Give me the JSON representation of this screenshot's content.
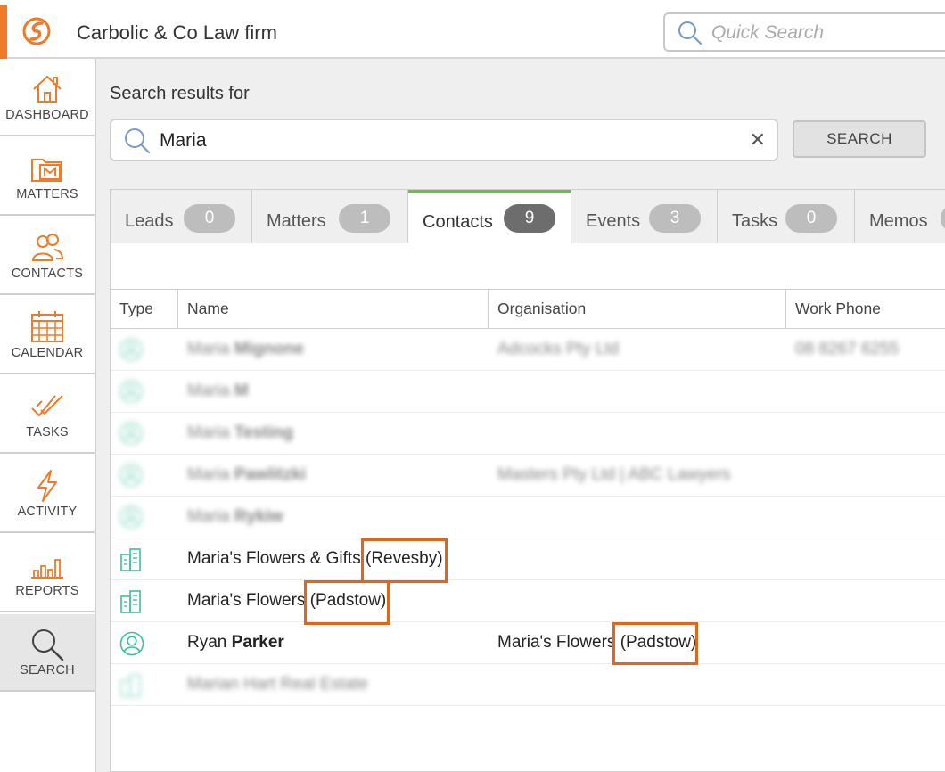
{
  "header": {
    "firm_name": "Carbolic & Co Law firm",
    "quick_search_placeholder": "Quick Search",
    "accent_color": "#ef7a2a"
  },
  "sidebar": {
    "items": [
      {
        "label": "DASHBOARD",
        "icon": "home-icon"
      },
      {
        "label": "MATTERS",
        "icon": "matters-folder-icon"
      },
      {
        "label": "CONTACTS",
        "icon": "contacts-icon"
      },
      {
        "label": "CALENDAR",
        "icon": "calendar-icon"
      },
      {
        "label": "TASKS",
        "icon": "tasks-check-icon"
      },
      {
        "label": "ACTIVITY",
        "icon": "lightning-icon"
      },
      {
        "label": "REPORTS",
        "icon": "bar-chart-icon"
      },
      {
        "label": "SEARCH",
        "icon": "search-icon",
        "active": true
      }
    ]
  },
  "search": {
    "results_for_label": "Search results for",
    "query": "Maria",
    "clear_symbol": "✕",
    "button_label": "SEARCH"
  },
  "tabs": [
    {
      "label": "Leads",
      "count": "0"
    },
    {
      "label": "Matters",
      "count": "1"
    },
    {
      "label": "Contacts",
      "count": "9",
      "active": true
    },
    {
      "label": "Events",
      "count": "3"
    },
    {
      "label": "Tasks",
      "count": "0"
    },
    {
      "label": "Memos",
      "count": ""
    }
  ],
  "table": {
    "columns": [
      "Type",
      "Name",
      "Organisation",
      "Work Phone"
    ],
    "rows": [
      {
        "type_icon": "person-icon",
        "first": "Maria",
        "last": "Mignone",
        "org": "Adcocks Pty Ltd",
        "phone": "08 8267 6255",
        "blurred": true
      },
      {
        "type_icon": "person-icon",
        "first": "Maria",
        "last": "M",
        "org": "",
        "phone": "",
        "blurred": true
      },
      {
        "type_icon": "person-icon",
        "first": "Maria",
        "last": "Testing",
        "org": "",
        "phone": "",
        "blurred": true
      },
      {
        "type_icon": "person-icon",
        "first": "Maria",
        "last": "Pawlitzki",
        "org": "Masters Pty Ltd | ABC Lawyers",
        "phone": "",
        "blurred": true
      },
      {
        "type_icon": "person-icon",
        "first": "Maria",
        "last": "Rykiw",
        "org": "",
        "phone": "",
        "blurred": true
      },
      {
        "type_icon": "building-icon",
        "name": "Maria's Flowers & Gifts",
        "suffix": "(Revesby)",
        "org": "",
        "phone": ""
      },
      {
        "type_icon": "building-icon",
        "name": "Maria's Flowers",
        "suffix": "(Padstow)",
        "org": "",
        "phone": ""
      },
      {
        "type_icon": "person-icon",
        "first": "Ryan",
        "last": "Parker",
        "org_name": "Maria's Flowers",
        "org_suffix": "(Padstow)",
        "phone": ""
      },
      {
        "type_icon": "building-icon",
        "name": "Marian Hart Real Estate",
        "org": "",
        "phone": "",
        "blurred": true
      }
    ]
  },
  "colors": {
    "icon_teal": "#3dbf9f",
    "highlight_box": "#e2651c",
    "active_tab_bar": "#6abf4b"
  }
}
